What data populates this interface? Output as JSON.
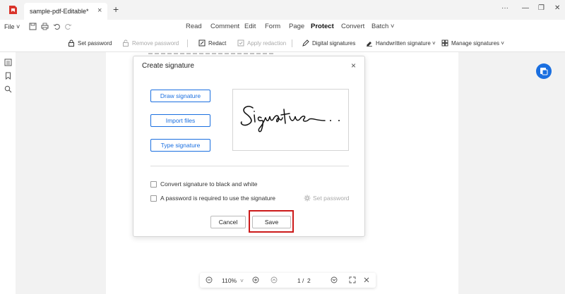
{
  "titlebar": {
    "tab_label": "sample-pdf-Editable*",
    "tab_close": "×",
    "new_tab": "+",
    "more": "···",
    "minimize": "—",
    "restore": "❐",
    "close": "✕"
  },
  "menubar": {
    "file_label": "File ˅",
    "tabs": [
      "Read",
      "Comment",
      "Edit",
      "Form",
      "Page",
      "Protect",
      "Convert",
      "Batch ˅"
    ],
    "active_tab": "Protect"
  },
  "ribbon": {
    "set_password": "Set password",
    "remove_password": "Remove password",
    "redact": "Redact",
    "apply_redaction": "Apply redaction",
    "digital_signatures": "Digital signatures",
    "handwritten_signature": "Handwritten signature ˅",
    "manage_signatures": "Manage signatures ˅"
  },
  "dialog": {
    "title": "Create signature",
    "close": "×",
    "options": [
      "Draw signature",
      "Import files",
      "Type signature"
    ],
    "convert_bw_label": "Convert signature to black and white",
    "password_required_label": "A password is required to use the signature",
    "set_password_label": "Set password",
    "cancel_label": "Cancel",
    "save_label": "Save"
  },
  "zoombar": {
    "zoom_value": "110%",
    "zoom_caret": "˅",
    "page_current": "1",
    "page_sep": "/",
    "page_total": "2"
  },
  "colors": {
    "accent": "#1a6fe0",
    "highlight_border": "#cc1a1a",
    "logo_red": "#d9342b"
  }
}
